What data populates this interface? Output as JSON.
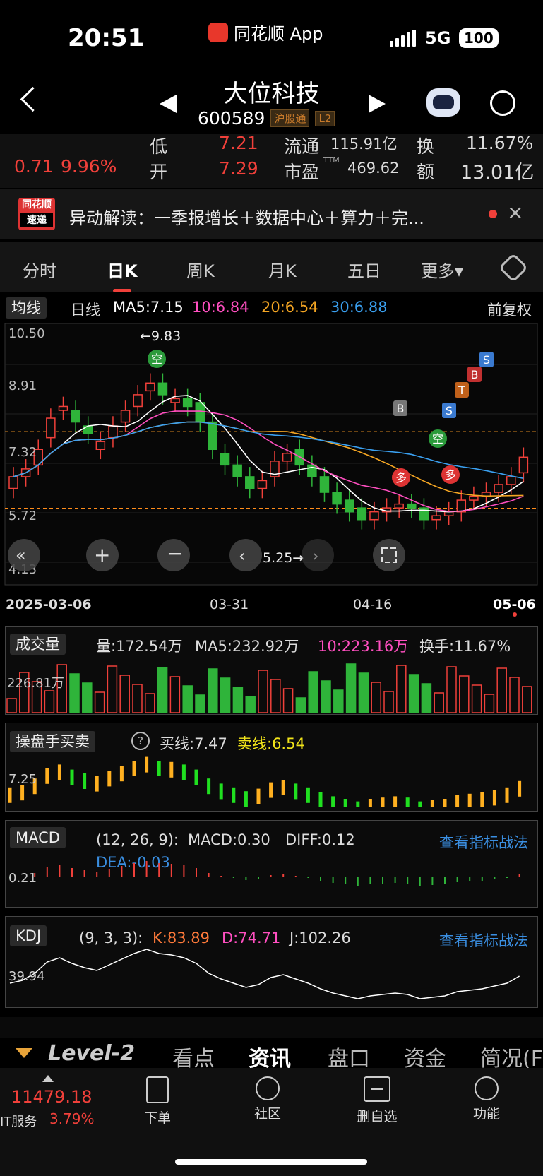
{
  "status_bar": {
    "time": "20:51",
    "app_name": "同花顺 App",
    "network": "5G",
    "battery": "100"
  },
  "header": {
    "title": "大位科技",
    "code": "600589",
    "tag_market": "沪股通",
    "tag_level": "L2"
  },
  "quote": {
    "change": "0.71",
    "change_pct": "9.96%",
    "low_label": "低",
    "low": "7.21",
    "open_label": "开",
    "open": "7.29",
    "float_label": "流通",
    "float_value": "115.91亿",
    "pe_label": "市盈",
    "pe_sup": "TTM",
    "pe_value": "469.62",
    "turnover_label": "换",
    "turnover": "11.67%",
    "amount_label": "额",
    "amount": "13.01亿"
  },
  "news": {
    "logo_top": "同花顺",
    "logo_bottom": "速递",
    "text": "异动解读：一季报增长＋数据中心＋算力＋完..."
  },
  "tabs": [
    "分时",
    "日K",
    "周K",
    "月K",
    "五日",
    "更多▾"
  ],
  "active_tab": "日K",
  "ma": {
    "dropdown": "均线",
    "period": "日线",
    "ma5": "MA5:7.15",
    "ma10": "10:6.84",
    "ma20": "20:6.54",
    "ma30": "30:6.88",
    "adjust": "前复权"
  },
  "kline": {
    "y_labels": [
      "10.50",
      "8.91",
      "7.32",
      "5.72",
      "4.13"
    ],
    "high_marker": "←9.83",
    "low_marker": "5.25→",
    "x_labels": [
      "2025-03-06",
      "03-31",
      "04-16",
      "05-06"
    ],
    "signals": [
      "空",
      "空",
      "B",
      "S",
      "T",
      "B",
      "S",
      "多",
      "多"
    ]
  },
  "volume": {
    "dropdown": "成交量",
    "vol": "量:172.54万",
    "ma5": "MA5:232.92万",
    "ma10": "10:223.16万",
    "turnover": "换手:11.67%",
    "axis": "226.81万"
  },
  "trader": {
    "dropdown": "操盘手买卖",
    "buy": "买线:7.47",
    "sell": "卖线:6.54",
    "axis": "7.25"
  },
  "macd": {
    "dropdown": "MACD",
    "params": "(12, 26, 9):",
    "macd": "MACD:0.30",
    "diff": "DIFF:0.12",
    "dea": "DEA:-0.03",
    "axis": "0.21",
    "link": "查看指标战法"
  },
  "kdj": {
    "dropdown": "KDJ",
    "params": "(9, 3, 3):",
    "k": "K:83.89",
    "d": "D:74.71",
    "j": "J:102.26",
    "axis": "39.94",
    "link": "查看指标战法"
  },
  "subnav": [
    "Level-2",
    "看点",
    "资讯",
    "盘口",
    "资金",
    "简况(F"
  ],
  "bottom": {
    "index_value": "11479.18",
    "index_name": "IT服务",
    "index_pct": "3.79%",
    "buttons": [
      "下单",
      "社区",
      "删自选",
      "功能"
    ]
  },
  "colors": {
    "up": "#f0403a",
    "down": "#2fb43a",
    "ma5": "#ffffff",
    "ma10": "#ff4fc0",
    "ma20": "#f5a623",
    "ma30": "#3aa0f0"
  }
}
